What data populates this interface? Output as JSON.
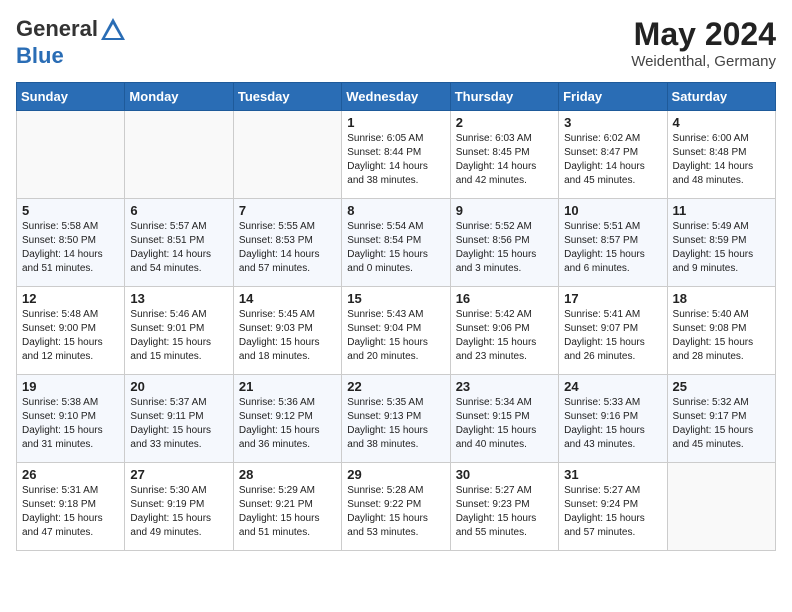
{
  "header": {
    "logo_general": "General",
    "logo_blue": "Blue",
    "month": "May 2024",
    "location": "Weidenthal, Germany"
  },
  "weekdays": [
    "Sunday",
    "Monday",
    "Tuesday",
    "Wednesday",
    "Thursday",
    "Friday",
    "Saturday"
  ],
  "weeks": [
    [
      {
        "day": "",
        "info": ""
      },
      {
        "day": "",
        "info": ""
      },
      {
        "day": "",
        "info": ""
      },
      {
        "day": "1",
        "info": "Sunrise: 6:05 AM\nSunset: 8:44 PM\nDaylight: 14 hours\nand 38 minutes."
      },
      {
        "day": "2",
        "info": "Sunrise: 6:03 AM\nSunset: 8:45 PM\nDaylight: 14 hours\nand 42 minutes."
      },
      {
        "day": "3",
        "info": "Sunrise: 6:02 AM\nSunset: 8:47 PM\nDaylight: 14 hours\nand 45 minutes."
      },
      {
        "day": "4",
        "info": "Sunrise: 6:00 AM\nSunset: 8:48 PM\nDaylight: 14 hours\nand 48 minutes."
      }
    ],
    [
      {
        "day": "5",
        "info": "Sunrise: 5:58 AM\nSunset: 8:50 PM\nDaylight: 14 hours\nand 51 minutes."
      },
      {
        "day": "6",
        "info": "Sunrise: 5:57 AM\nSunset: 8:51 PM\nDaylight: 14 hours\nand 54 minutes."
      },
      {
        "day": "7",
        "info": "Sunrise: 5:55 AM\nSunset: 8:53 PM\nDaylight: 14 hours\nand 57 minutes."
      },
      {
        "day": "8",
        "info": "Sunrise: 5:54 AM\nSunset: 8:54 PM\nDaylight: 15 hours\nand 0 minutes."
      },
      {
        "day": "9",
        "info": "Sunrise: 5:52 AM\nSunset: 8:56 PM\nDaylight: 15 hours\nand 3 minutes."
      },
      {
        "day": "10",
        "info": "Sunrise: 5:51 AM\nSunset: 8:57 PM\nDaylight: 15 hours\nand 6 minutes."
      },
      {
        "day": "11",
        "info": "Sunrise: 5:49 AM\nSunset: 8:59 PM\nDaylight: 15 hours\nand 9 minutes."
      }
    ],
    [
      {
        "day": "12",
        "info": "Sunrise: 5:48 AM\nSunset: 9:00 PM\nDaylight: 15 hours\nand 12 minutes."
      },
      {
        "day": "13",
        "info": "Sunrise: 5:46 AM\nSunset: 9:01 PM\nDaylight: 15 hours\nand 15 minutes."
      },
      {
        "day": "14",
        "info": "Sunrise: 5:45 AM\nSunset: 9:03 PM\nDaylight: 15 hours\nand 18 minutes."
      },
      {
        "day": "15",
        "info": "Sunrise: 5:43 AM\nSunset: 9:04 PM\nDaylight: 15 hours\nand 20 minutes."
      },
      {
        "day": "16",
        "info": "Sunrise: 5:42 AM\nSunset: 9:06 PM\nDaylight: 15 hours\nand 23 minutes."
      },
      {
        "day": "17",
        "info": "Sunrise: 5:41 AM\nSunset: 9:07 PM\nDaylight: 15 hours\nand 26 minutes."
      },
      {
        "day": "18",
        "info": "Sunrise: 5:40 AM\nSunset: 9:08 PM\nDaylight: 15 hours\nand 28 minutes."
      }
    ],
    [
      {
        "day": "19",
        "info": "Sunrise: 5:38 AM\nSunset: 9:10 PM\nDaylight: 15 hours\nand 31 minutes."
      },
      {
        "day": "20",
        "info": "Sunrise: 5:37 AM\nSunset: 9:11 PM\nDaylight: 15 hours\nand 33 minutes."
      },
      {
        "day": "21",
        "info": "Sunrise: 5:36 AM\nSunset: 9:12 PM\nDaylight: 15 hours\nand 36 minutes."
      },
      {
        "day": "22",
        "info": "Sunrise: 5:35 AM\nSunset: 9:13 PM\nDaylight: 15 hours\nand 38 minutes."
      },
      {
        "day": "23",
        "info": "Sunrise: 5:34 AM\nSunset: 9:15 PM\nDaylight: 15 hours\nand 40 minutes."
      },
      {
        "day": "24",
        "info": "Sunrise: 5:33 AM\nSunset: 9:16 PM\nDaylight: 15 hours\nand 43 minutes."
      },
      {
        "day": "25",
        "info": "Sunrise: 5:32 AM\nSunset: 9:17 PM\nDaylight: 15 hours\nand 45 minutes."
      }
    ],
    [
      {
        "day": "26",
        "info": "Sunrise: 5:31 AM\nSunset: 9:18 PM\nDaylight: 15 hours\nand 47 minutes."
      },
      {
        "day": "27",
        "info": "Sunrise: 5:30 AM\nSunset: 9:19 PM\nDaylight: 15 hours\nand 49 minutes."
      },
      {
        "day": "28",
        "info": "Sunrise: 5:29 AM\nSunset: 9:21 PM\nDaylight: 15 hours\nand 51 minutes."
      },
      {
        "day": "29",
        "info": "Sunrise: 5:28 AM\nSunset: 9:22 PM\nDaylight: 15 hours\nand 53 minutes."
      },
      {
        "day": "30",
        "info": "Sunrise: 5:27 AM\nSunset: 9:23 PM\nDaylight: 15 hours\nand 55 minutes."
      },
      {
        "day": "31",
        "info": "Sunrise: 5:27 AM\nSunset: 9:24 PM\nDaylight: 15 hours\nand 57 minutes."
      },
      {
        "day": "",
        "info": ""
      }
    ]
  ]
}
